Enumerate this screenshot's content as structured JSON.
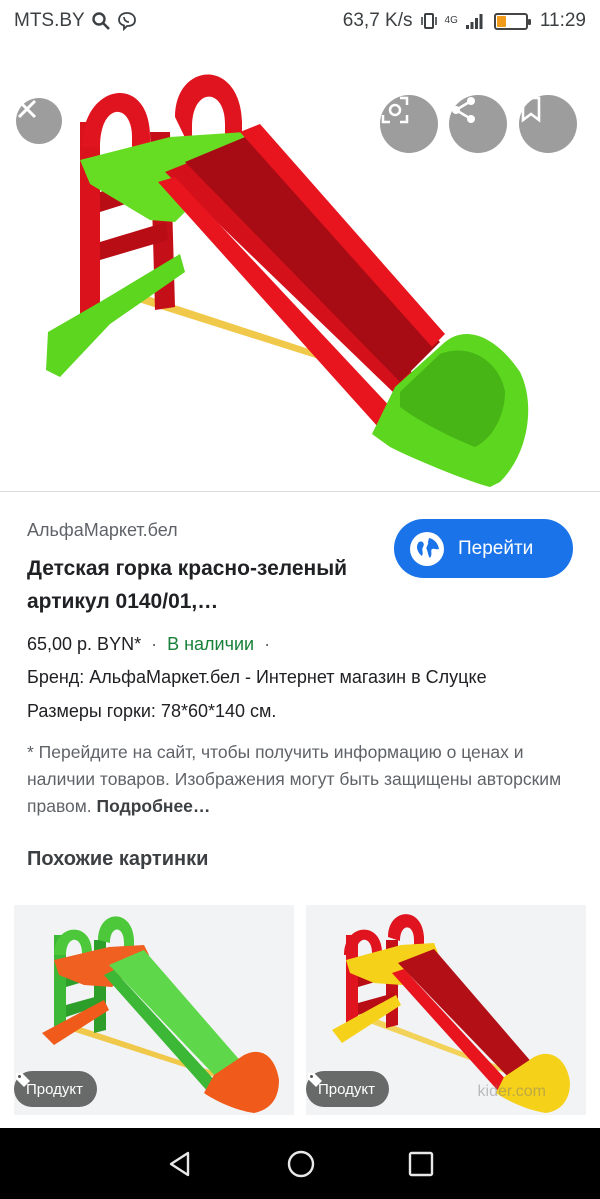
{
  "status_bar": {
    "carrier": "MTS.BY",
    "speed": "63,7 K/s",
    "network": "4G",
    "battery_level": 0.32,
    "time": "11:29"
  },
  "hero": {
    "image_alt": "Детская горка красно-зеленая",
    "colors": {
      "red": "#e0141e",
      "green": "#5cd61e",
      "yellow": "#f3d25a"
    }
  },
  "details": {
    "source": "АльфаМаркет.бел",
    "title": "Детская горка красно-зеленый артикул 0140/01,…",
    "visit_button": "Перейти",
    "price": "65,00 р. BYN*",
    "availability": "В наличии",
    "brand_line": "Бренд: АльфаМаркет.бел - Интернет магазин в Слуцке",
    "sizes_line": "Размеры горки: 78*60*140 см.",
    "note": "* Перейдите на сайт, чтобы получить информацию о ценах и наличии товаров. Изображения могут быть защищены авторским правом.",
    "more_link": "Подробнее…"
  },
  "similar": {
    "title": "Похожие картинки",
    "items": [
      {
        "badge": "Продукт"
      },
      {
        "badge": "Продукт",
        "watermark": "kider.com"
      }
    ]
  },
  "icons": [
    "search-icon",
    "viber-icon",
    "vibrate-icon",
    "signal-icon",
    "battery-icon",
    "close-icon",
    "lens-icon",
    "share-icon",
    "bookmark-icon",
    "globe-icon",
    "tag-icon",
    "back-icon",
    "home-icon",
    "recents-icon"
  ]
}
